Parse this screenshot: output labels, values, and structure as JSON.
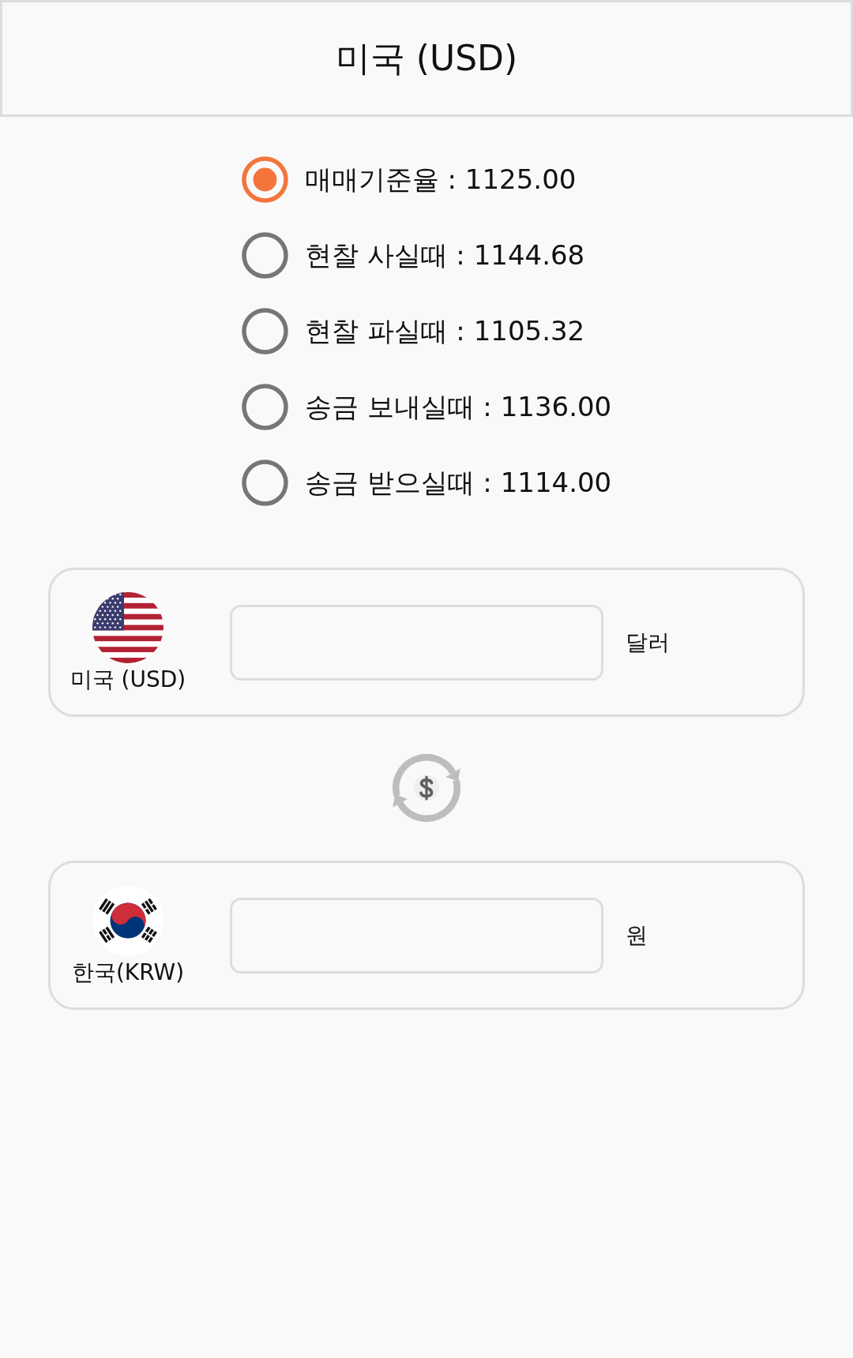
{
  "title": "미국 (USD)",
  "rates": [
    {
      "label": "매매기준율 : 1125.00",
      "selected": true
    },
    {
      "label": "현찰 사실때 : 1144.68",
      "selected": false
    },
    {
      "label": "현찰 파실때 : 1105.32",
      "selected": false
    },
    {
      "label": "송금 보내실때 : 1136.00",
      "selected": false
    },
    {
      "label": "송금 받으실때 : 1114.00",
      "selected": false
    }
  ],
  "currencies": [
    {
      "kind": "us",
      "name": "미국 (USD)",
      "unit": "달러"
    },
    {
      "kind": "kr",
      "name": "한국(KRW)",
      "unit": "원"
    }
  ]
}
